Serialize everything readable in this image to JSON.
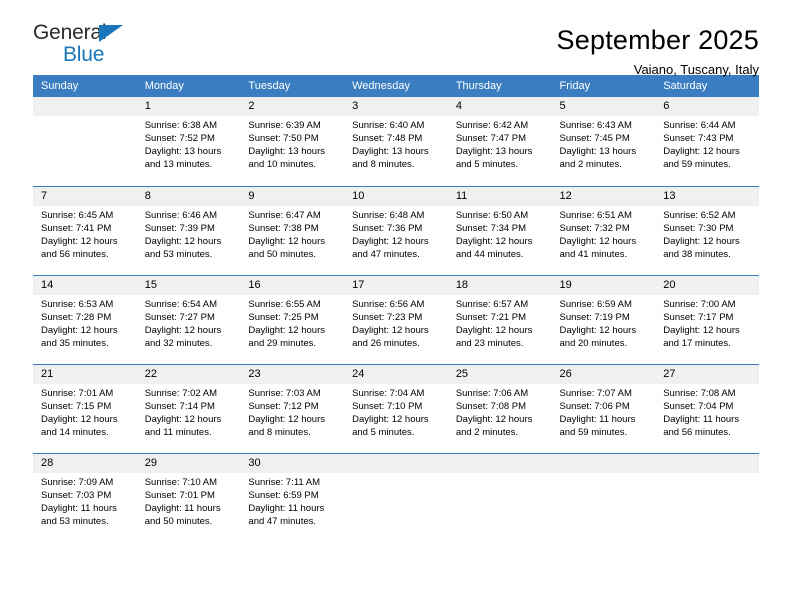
{
  "brand": {
    "name_part1": "General",
    "name_part2": "Blue",
    "colors": {
      "blue": "#1b75bb",
      "dark": "#2b2b2b"
    }
  },
  "header": {
    "title": "September 2025",
    "subtitle": "Vaiano, Tuscany, Italy"
  },
  "theme": {
    "header_blue": "#3a7dc0",
    "daynum_band": "#f0f0f0"
  },
  "calendar": {
    "weekdays": [
      "Sunday",
      "Monday",
      "Tuesday",
      "Wednesday",
      "Thursday",
      "Friday",
      "Saturday"
    ],
    "labels": {
      "sunrise": "Sunrise:",
      "sunset": "Sunset:",
      "daylight": "Daylight:"
    },
    "weeks": [
      [
        {
          "day": ""
        },
        {
          "day": "1",
          "sunrise": "Sunrise: 6:38 AM",
          "sunset": "Sunset: 7:52 PM",
          "daylight": "Daylight: 13 hours and 13 minutes."
        },
        {
          "day": "2",
          "sunrise": "Sunrise: 6:39 AM",
          "sunset": "Sunset: 7:50 PM",
          "daylight": "Daylight: 13 hours and 10 minutes."
        },
        {
          "day": "3",
          "sunrise": "Sunrise: 6:40 AM",
          "sunset": "Sunset: 7:48 PM",
          "daylight": "Daylight: 13 hours and 8 minutes."
        },
        {
          "day": "4",
          "sunrise": "Sunrise: 6:42 AM",
          "sunset": "Sunset: 7:47 PM",
          "daylight": "Daylight: 13 hours and 5 minutes."
        },
        {
          "day": "5",
          "sunrise": "Sunrise: 6:43 AM",
          "sunset": "Sunset: 7:45 PM",
          "daylight": "Daylight: 13 hours and 2 minutes."
        },
        {
          "day": "6",
          "sunrise": "Sunrise: 6:44 AM",
          "sunset": "Sunset: 7:43 PM",
          "daylight": "Daylight: 12 hours and 59 minutes."
        }
      ],
      [
        {
          "day": "7",
          "sunrise": "Sunrise: 6:45 AM",
          "sunset": "Sunset: 7:41 PM",
          "daylight": "Daylight: 12 hours and 56 minutes."
        },
        {
          "day": "8",
          "sunrise": "Sunrise: 6:46 AM",
          "sunset": "Sunset: 7:39 PM",
          "daylight": "Daylight: 12 hours and 53 minutes."
        },
        {
          "day": "9",
          "sunrise": "Sunrise: 6:47 AM",
          "sunset": "Sunset: 7:38 PM",
          "daylight": "Daylight: 12 hours and 50 minutes."
        },
        {
          "day": "10",
          "sunrise": "Sunrise: 6:48 AM",
          "sunset": "Sunset: 7:36 PM",
          "daylight": "Daylight: 12 hours and 47 minutes."
        },
        {
          "day": "11",
          "sunrise": "Sunrise: 6:50 AM",
          "sunset": "Sunset: 7:34 PM",
          "daylight": "Daylight: 12 hours and 44 minutes."
        },
        {
          "day": "12",
          "sunrise": "Sunrise: 6:51 AM",
          "sunset": "Sunset: 7:32 PM",
          "daylight": "Daylight: 12 hours and 41 minutes."
        },
        {
          "day": "13",
          "sunrise": "Sunrise: 6:52 AM",
          "sunset": "Sunset: 7:30 PM",
          "daylight": "Daylight: 12 hours and 38 minutes."
        }
      ],
      [
        {
          "day": "14",
          "sunrise": "Sunrise: 6:53 AM",
          "sunset": "Sunset: 7:28 PM",
          "daylight": "Daylight: 12 hours and 35 minutes."
        },
        {
          "day": "15",
          "sunrise": "Sunrise: 6:54 AM",
          "sunset": "Sunset: 7:27 PM",
          "daylight": "Daylight: 12 hours and 32 minutes."
        },
        {
          "day": "16",
          "sunrise": "Sunrise: 6:55 AM",
          "sunset": "Sunset: 7:25 PM",
          "daylight": "Daylight: 12 hours and 29 minutes."
        },
        {
          "day": "17",
          "sunrise": "Sunrise: 6:56 AM",
          "sunset": "Sunset: 7:23 PM",
          "daylight": "Daylight: 12 hours and 26 minutes."
        },
        {
          "day": "18",
          "sunrise": "Sunrise: 6:57 AM",
          "sunset": "Sunset: 7:21 PM",
          "daylight": "Daylight: 12 hours and 23 minutes."
        },
        {
          "day": "19",
          "sunrise": "Sunrise: 6:59 AM",
          "sunset": "Sunset: 7:19 PM",
          "daylight": "Daylight: 12 hours and 20 minutes."
        },
        {
          "day": "20",
          "sunrise": "Sunrise: 7:00 AM",
          "sunset": "Sunset: 7:17 PM",
          "daylight": "Daylight: 12 hours and 17 minutes."
        }
      ],
      [
        {
          "day": "21",
          "sunrise": "Sunrise: 7:01 AM",
          "sunset": "Sunset: 7:15 PM",
          "daylight": "Daylight: 12 hours and 14 minutes."
        },
        {
          "day": "22",
          "sunrise": "Sunrise: 7:02 AM",
          "sunset": "Sunset: 7:14 PM",
          "daylight": "Daylight: 12 hours and 11 minutes."
        },
        {
          "day": "23",
          "sunrise": "Sunrise: 7:03 AM",
          "sunset": "Sunset: 7:12 PM",
          "daylight": "Daylight: 12 hours and 8 minutes."
        },
        {
          "day": "24",
          "sunrise": "Sunrise: 7:04 AM",
          "sunset": "Sunset: 7:10 PM",
          "daylight": "Daylight: 12 hours and 5 minutes."
        },
        {
          "day": "25",
          "sunrise": "Sunrise: 7:06 AM",
          "sunset": "Sunset: 7:08 PM",
          "daylight": "Daylight: 12 hours and 2 minutes."
        },
        {
          "day": "26",
          "sunrise": "Sunrise: 7:07 AM",
          "sunset": "Sunset: 7:06 PM",
          "daylight": "Daylight: 11 hours and 59 minutes."
        },
        {
          "day": "27",
          "sunrise": "Sunrise: 7:08 AM",
          "sunset": "Sunset: 7:04 PM",
          "daylight": "Daylight: 11 hours and 56 minutes."
        }
      ],
      [
        {
          "day": "28",
          "sunrise": "Sunrise: 7:09 AM",
          "sunset": "Sunset: 7:03 PM",
          "daylight": "Daylight: 11 hours and 53 minutes."
        },
        {
          "day": "29",
          "sunrise": "Sunrise: 7:10 AM",
          "sunset": "Sunset: 7:01 PM",
          "daylight": "Daylight: 11 hours and 50 minutes."
        },
        {
          "day": "30",
          "sunrise": "Sunrise: 7:11 AM",
          "sunset": "Sunset: 6:59 PM",
          "daylight": "Daylight: 11 hours and 47 minutes."
        },
        {
          "day": ""
        },
        {
          "day": ""
        },
        {
          "day": ""
        },
        {
          "day": ""
        }
      ]
    ]
  }
}
